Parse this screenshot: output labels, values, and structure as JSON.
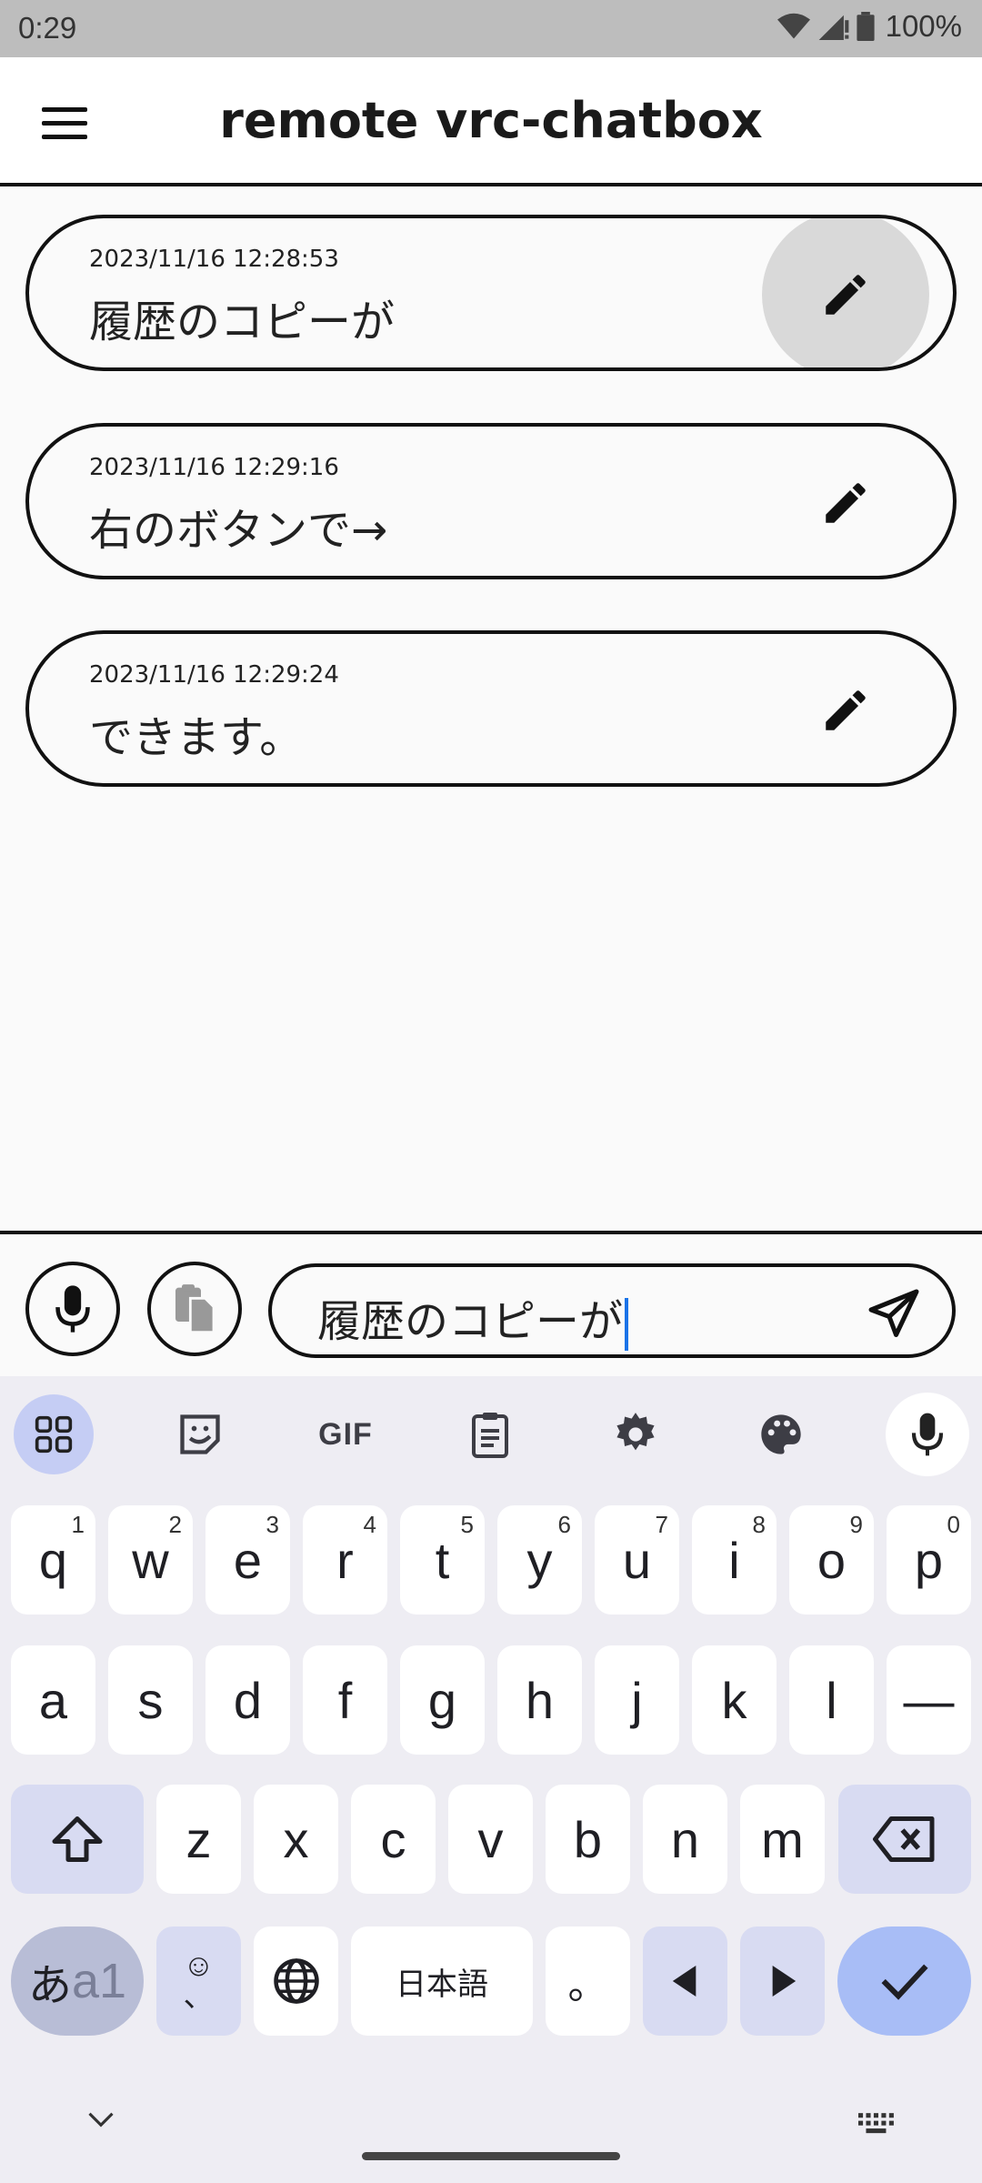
{
  "status_bar": {
    "time": "0:29",
    "battery": "100%"
  },
  "app_bar": {
    "title": "remote vrc-chatbox"
  },
  "history": [
    {
      "timestamp": "2023/11/16 12:28:53",
      "message": "履歴のコピーが"
    },
    {
      "timestamp": "2023/11/16 12:29:16",
      "message": "右のボタンで→"
    },
    {
      "timestamp": "2023/11/16 12:29:24",
      "message": "できます。"
    }
  ],
  "input_bar": {
    "text": "履歴のコピーが"
  },
  "keyboard": {
    "toolbar": {
      "gif": "GIF"
    },
    "row1": [
      {
        "k": "q",
        "s": "1"
      },
      {
        "k": "w",
        "s": "2"
      },
      {
        "k": "e",
        "s": "3"
      },
      {
        "k": "r",
        "s": "4"
      },
      {
        "k": "t",
        "s": "5"
      },
      {
        "k": "y",
        "s": "6"
      },
      {
        "k": "u",
        "s": "7"
      },
      {
        "k": "i",
        "s": "8"
      },
      {
        "k": "o",
        "s": "9"
      },
      {
        "k": "p",
        "s": "0"
      }
    ],
    "row2": [
      "a",
      "s",
      "d",
      "f",
      "g",
      "h",
      "j",
      "k",
      "l",
      "—"
    ],
    "row3": [
      "z",
      "x",
      "c",
      "v",
      "b",
      "n",
      "m"
    ],
    "mode_key_a": "あ",
    "mode_key_b": "a1",
    "emoji_key_top": "☺",
    "emoji_key_bottom": "、",
    "space_label": "日本語",
    "period_key": "。"
  },
  "colors": {
    "accent": "#1a73e8",
    "keyboard_bg": "#eeedf3",
    "enter_key": "#a8bdf6"
  }
}
